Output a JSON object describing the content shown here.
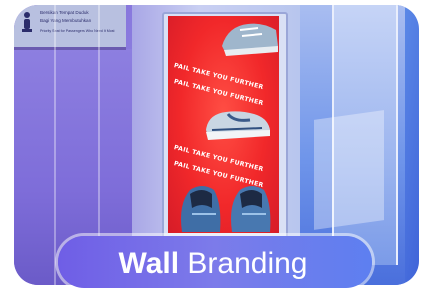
{
  "sign": {
    "line1": "Bersikan Tempat Duduk",
    "line2": "Bagi Yang Membutuhkan",
    "line3": "Priority Seat for Passengers Who Need It Most"
  },
  "poster": {
    "slogan": "PAIL TAKE YOU FURTHER"
  },
  "label": {
    "bold_word": "Wall",
    "regular_word": "Branding"
  }
}
